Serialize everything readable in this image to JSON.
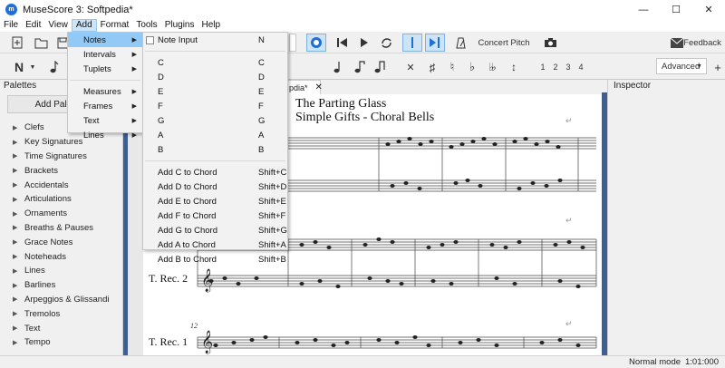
{
  "window": {
    "title": "MuseScore 3: Softpedia*",
    "app_icon": "musescore-logo",
    "controls": [
      "—",
      "☐",
      "✕"
    ]
  },
  "menubar": {
    "items": [
      "File",
      "Edit",
      "View",
      "Add",
      "Format",
      "Tools",
      "Plugins",
      "Help"
    ]
  },
  "toolbar": {
    "concert_pitch": "Concert Pitch",
    "feedback": "Feedback",
    "workspace": "Advanced",
    "voices": [
      "1",
      "2",
      "3",
      "4"
    ],
    "note_input_letter": "N"
  },
  "palettes": {
    "header": "Palettes",
    "add_button": "Add Palettes",
    "items": [
      "Clefs",
      "Key Signatures",
      "Time Signatures",
      "Brackets",
      "Accidentals",
      "Articulations",
      "Ornaments",
      "Breaths & Pauses",
      "Grace Notes",
      "Noteheads",
      "Lines",
      "Barlines",
      "Arpeggios & Glissandi",
      "Tremolos",
      "Text",
      "Tempo"
    ]
  },
  "inspector": {
    "header": "Inspector"
  },
  "score": {
    "tab_label": "pdia*",
    "title_partial": "The Parting Glass",
    "subtitle": "Simple Gifts - Choral Bells",
    "staff_labels": [
      "T. Rec. 2",
      "T. Rec. 1"
    ],
    "measure_number": "12",
    "enter_glyph": "↵"
  },
  "add_menu": {
    "items": [
      {
        "label": "Notes",
        "highlighted": true
      },
      {
        "label": "Intervals"
      },
      {
        "label": "Tuplets"
      },
      {
        "label": "Measures"
      },
      {
        "label": "Frames"
      },
      {
        "label": "Text"
      },
      {
        "label": "Lines"
      }
    ]
  },
  "notes_menu": {
    "note_input": {
      "label": "Note Input",
      "shortcut": "N"
    },
    "notes": [
      {
        "label": "C",
        "shortcut": "C"
      },
      {
        "label": "D",
        "shortcut": "D"
      },
      {
        "label": "E",
        "shortcut": "E"
      },
      {
        "label": "F",
        "shortcut": "F"
      },
      {
        "label": "G",
        "shortcut": "G"
      },
      {
        "label": "A",
        "shortcut": "A"
      },
      {
        "label": "B",
        "shortcut": "B"
      }
    ],
    "chords": [
      {
        "label": "Add C to Chord",
        "shortcut": "Shift+C"
      },
      {
        "label": "Add D to Chord",
        "shortcut": "Shift+D"
      },
      {
        "label": "Add E to Chord",
        "shortcut": "Shift+E"
      },
      {
        "label": "Add F to Chord",
        "shortcut": "Shift+F"
      },
      {
        "label": "Add G to Chord",
        "shortcut": "Shift+G"
      },
      {
        "label": "Add A to Chord",
        "shortcut": "Shift+A"
      },
      {
        "label": "Add B to Chord",
        "shortcut": "Shift+B"
      }
    ]
  },
  "status": {
    "mode": "Normal mode",
    "time": "1:01:000"
  },
  "colors": {
    "highlight": "#91c9f7",
    "menu_active": "#cde4f7",
    "score_border": "#3f5e8c"
  }
}
